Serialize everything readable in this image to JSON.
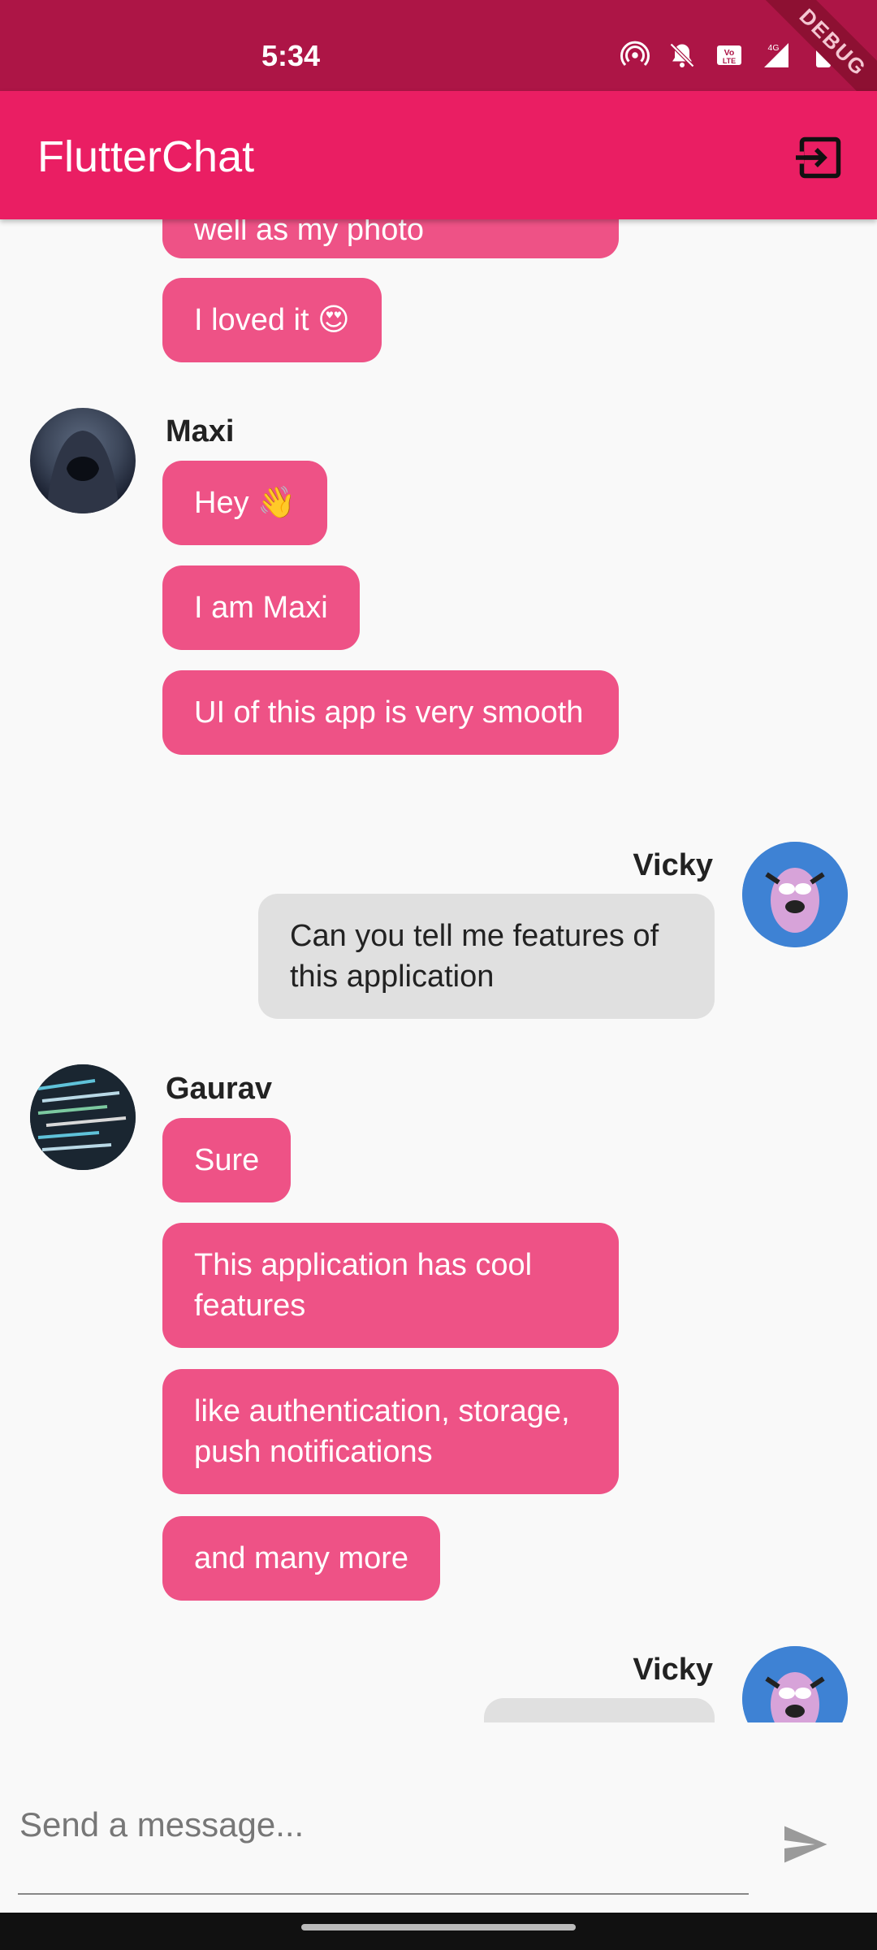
{
  "status_bar": {
    "time": "5:34",
    "debug_label": "DEBUG"
  },
  "app_bar": {
    "title": "FlutterChat"
  },
  "messages": [
    {
      "sender": "",
      "text": "well as my photo"
    },
    {
      "sender": "",
      "text": "I loved it 😍"
    },
    {
      "sender": "Maxi",
      "text": "Hey 👋"
    },
    {
      "sender": "",
      "text": "I am Maxi"
    },
    {
      "sender": "",
      "text": "UI of this app is very smooth"
    },
    {
      "sender": "Vicky",
      "text": "Can you tell me features of this application"
    },
    {
      "sender": "Gaurav",
      "text": "Sure"
    },
    {
      "sender": "",
      "text": "This application has cool features"
    },
    {
      "sender": "",
      "text": "like authentication, storage, push notifications"
    },
    {
      "sender": "",
      "text": "and many more"
    },
    {
      "sender": "Vicky",
      "text": ""
    }
  ],
  "composer": {
    "placeholder": "Send a message..."
  },
  "colors": {
    "accent": "#ea1e63",
    "status_bar": "#ad1546",
    "bubble_pink": "#ee5286",
    "bubble_grey": "#e0e0e0"
  },
  "icons": [
    "hotspot-icon",
    "bell-off-icon",
    "volte-icon",
    "signal-4g-icon",
    "battery-icon",
    "logout-icon",
    "send-icon"
  ]
}
